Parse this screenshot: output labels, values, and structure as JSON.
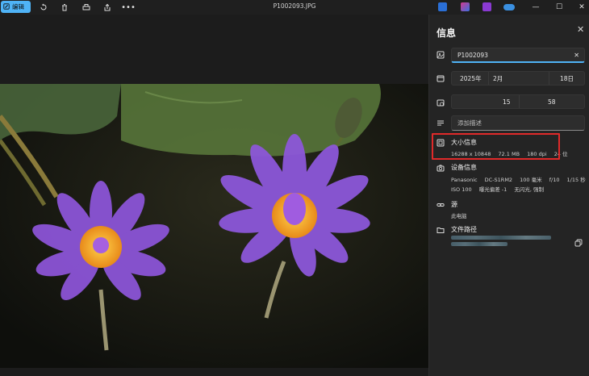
{
  "toolbar": {
    "edit_label": "编辑",
    "file_title": "P1002093.JPG"
  },
  "colors": {
    "accent": "#4fb3f6",
    "highlight": "#e02a2a",
    "panel_bg": "#242424"
  },
  "info_panel": {
    "title": "信息",
    "filename_value": "P1002093",
    "date": {
      "year": "2025年",
      "month": "2月",
      "day": "18日"
    },
    "time": {
      "hour": "15",
      "minute": "58"
    },
    "description_placeholder": "添加描述",
    "size": {
      "heading": "大小信息",
      "dimensions": "16288 x 10848",
      "filesize": "72.1 MB",
      "dpi": "180 dpi",
      "bitdepth": "24 位"
    },
    "device": {
      "heading": "设备信息",
      "make": "Panasonic",
      "model": "DC-S1RM2",
      "focal": "100 毫米",
      "fstop": "f/10",
      "shutter": "1/15 秒",
      "iso": "ISO 100",
      "exposure": "曝光偏差 -1",
      "flash": "无闪光, 强制"
    },
    "source": {
      "heading": "源",
      "value": "此电脑"
    },
    "path": {
      "heading": "文件路径"
    }
  }
}
